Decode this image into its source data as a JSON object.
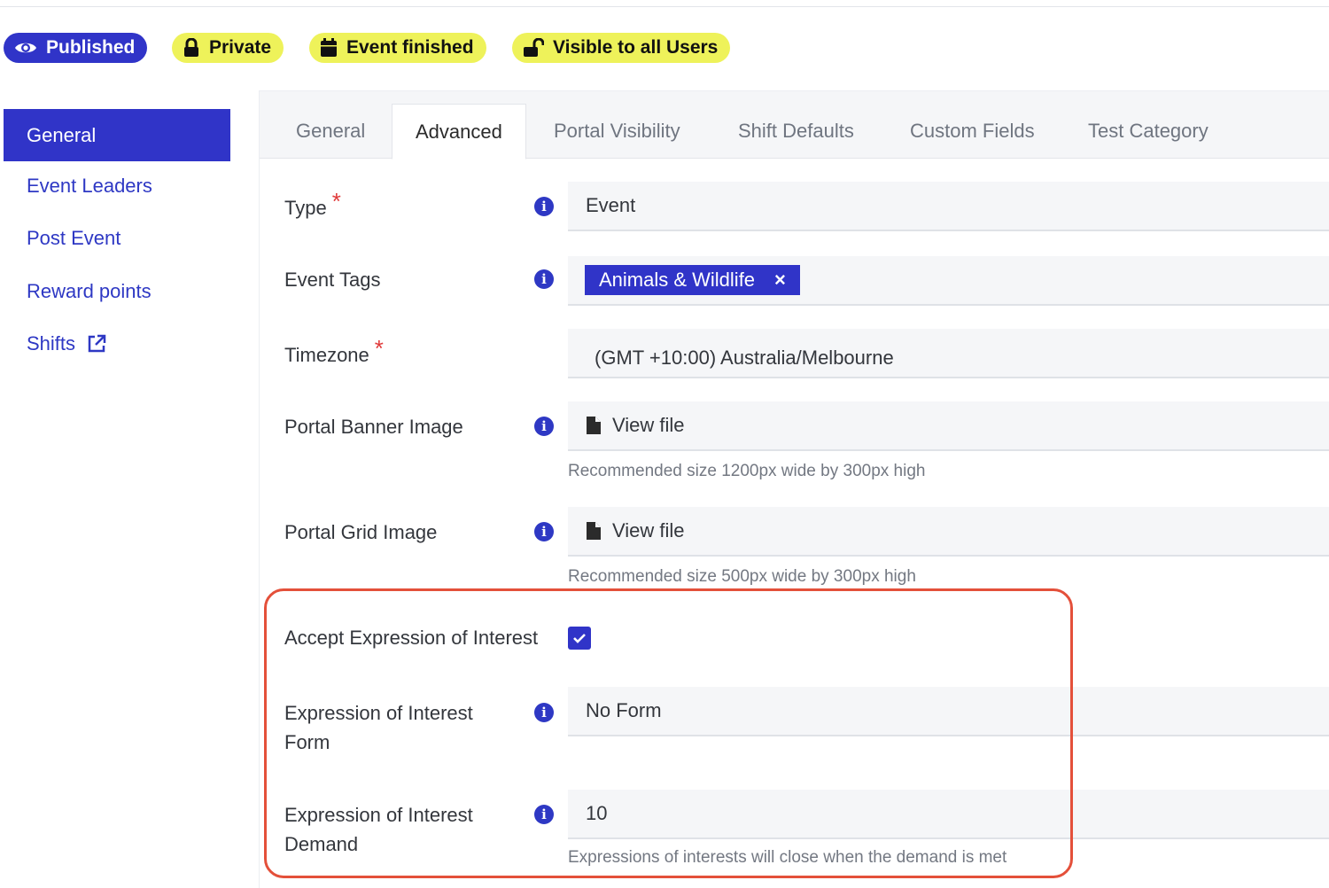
{
  "badges": [
    {
      "label": "Published",
      "icon": "eye-icon",
      "color": "#3034c8"
    },
    {
      "label": "Private",
      "icon": "lock-icon",
      "color": "#eef25a"
    },
    {
      "label": "Event finished",
      "icon": "calendar-icon",
      "color": "#eef25a"
    },
    {
      "label": "Visible to all Users",
      "icon": "unlock-icon",
      "color": "#eef25a"
    }
  ],
  "sidebar": {
    "items": [
      {
        "label": "General",
        "active": true
      },
      {
        "label": "Event Leaders"
      },
      {
        "label": "Post Event"
      },
      {
        "label": "Reward points"
      },
      {
        "label": "Shifts",
        "icon": "external-link-icon"
      }
    ]
  },
  "tabs": [
    {
      "label": "General"
    },
    {
      "label": "Advanced",
      "active": true
    },
    {
      "label": "Portal Visibility"
    },
    {
      "label": "Shift Defaults"
    },
    {
      "label": "Custom Fields"
    },
    {
      "label": "Test Category"
    }
  ],
  "form": {
    "type": {
      "label": "Type",
      "required": "*",
      "value": "Event"
    },
    "event_tags": {
      "label": "Event Tags",
      "tag": "Animals & Wildlife",
      "remove": "×"
    },
    "timezone": {
      "label": "Timezone",
      "required": "*",
      "value": "(GMT +10:00) Australia/Melbourne"
    },
    "portal_banner": {
      "label": "Portal Banner Image",
      "value": "View file",
      "help": "Recommended size 1200px wide by 300px high"
    },
    "portal_grid": {
      "label": "Portal Grid Image",
      "value": "View file",
      "help": "Recommended size 500px wide by 300px high"
    },
    "accept_eoi": {
      "label": "Accept Expression of Interest",
      "checked": true
    },
    "eoi_form": {
      "label_line1": "Expression of Interest",
      "label_line2": "Form",
      "value": "No Form"
    },
    "eoi_demand": {
      "label_line1": "Expression of Interest",
      "label_line2": "Demand",
      "value": "10",
      "help": "Expressions of interests will close when the demand is met"
    }
  },
  "colors": {
    "accent": "#3034c8",
    "badge_yellow": "#eef25a",
    "highlight": "#e4503a",
    "required": "#e03a3a"
  }
}
